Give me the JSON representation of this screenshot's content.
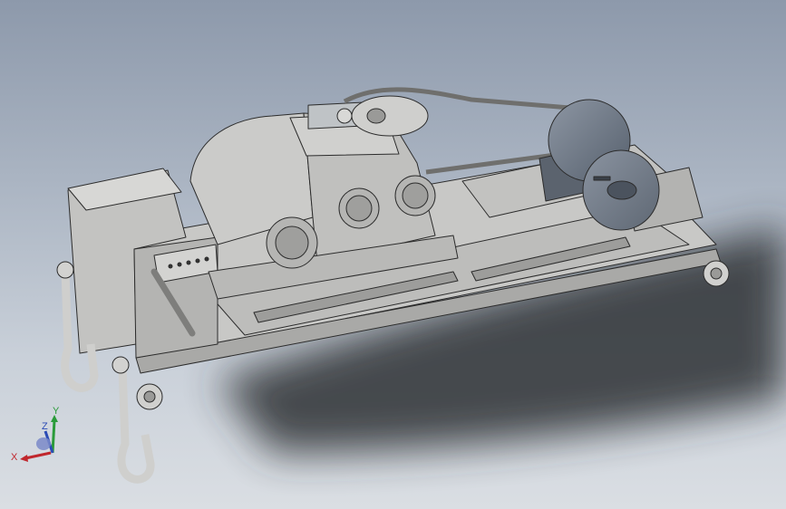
{
  "viewport": {
    "background_top": "#8d99ab",
    "background_bottom": "#dadee3"
  },
  "model": {
    "body_color": "#c8c8c6",
    "shade_color": "#a9a9a7",
    "edge_color": "#2c2c2c",
    "motor_color": "#6f7987",
    "motor_cap_color": "#7e8894",
    "shadow_color": "#2d3035"
  },
  "triad": {
    "x_label": "X",
    "y_label": "Y",
    "z_label": "Z",
    "x_color": "#c0272d",
    "y_color": "#2a9b3a",
    "z_color": "#2b4bb5"
  }
}
